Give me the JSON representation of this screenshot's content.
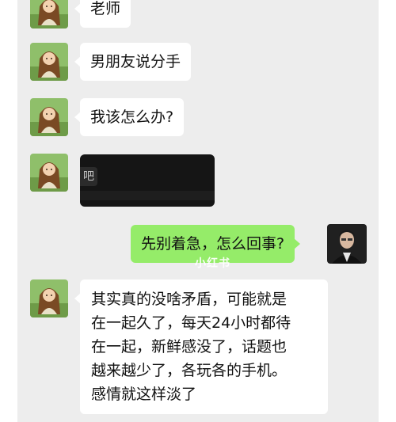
{
  "messages": [
    {
      "side": "left",
      "text": "老师"
    },
    {
      "side": "left",
      "text": "男朋友说分手"
    },
    {
      "side": "left",
      "text": "我该怎么办?"
    },
    {
      "side": "left",
      "media_label": "吧"
    },
    {
      "side": "right",
      "text": "先别着急，怎么回事?"
    },
    {
      "side": "left",
      "lines": [
        "其实真的没啥矛盾，可能就是",
        "在一起久了，每天24小时都待",
        "在一起，新鲜感没了，话题也",
        "越来越少了，各玩各的手机。",
        "感情就这样淡了"
      ]
    }
  ],
  "watermark": "小红书",
  "colors": {
    "chat_bg": "#ededed",
    "bubble_in": "#ffffff",
    "bubble_out": "#95ec69"
  },
  "icons": {
    "contact_avatar": "cartoon-girl-avatar",
    "user_avatar": "man-in-suit-avatar"
  }
}
